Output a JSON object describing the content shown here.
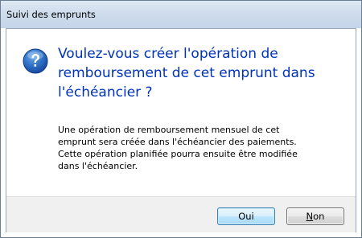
{
  "window": {
    "title": "Suivi des emprunts"
  },
  "dialog": {
    "icon": "question-icon",
    "heading": "Voulez-vous créer l'opération de remboursement de cet emprunt dans l'échéancier ?",
    "message_lines": [
      "Une opération de remboursement mensuel de cet",
      "emprunt sera créée dans l'échéancier des paiements.",
      "Cette opération planifiée pourra ensuite être modifiée",
      "dans l'échéancier."
    ]
  },
  "buttons": {
    "yes_label": "Oui",
    "no_mnemonic": "N",
    "no_rest": "on"
  },
  "colors": {
    "heading": "#0033b9",
    "icon": "#1f5fb8",
    "footer": "#f0f0f0"
  }
}
